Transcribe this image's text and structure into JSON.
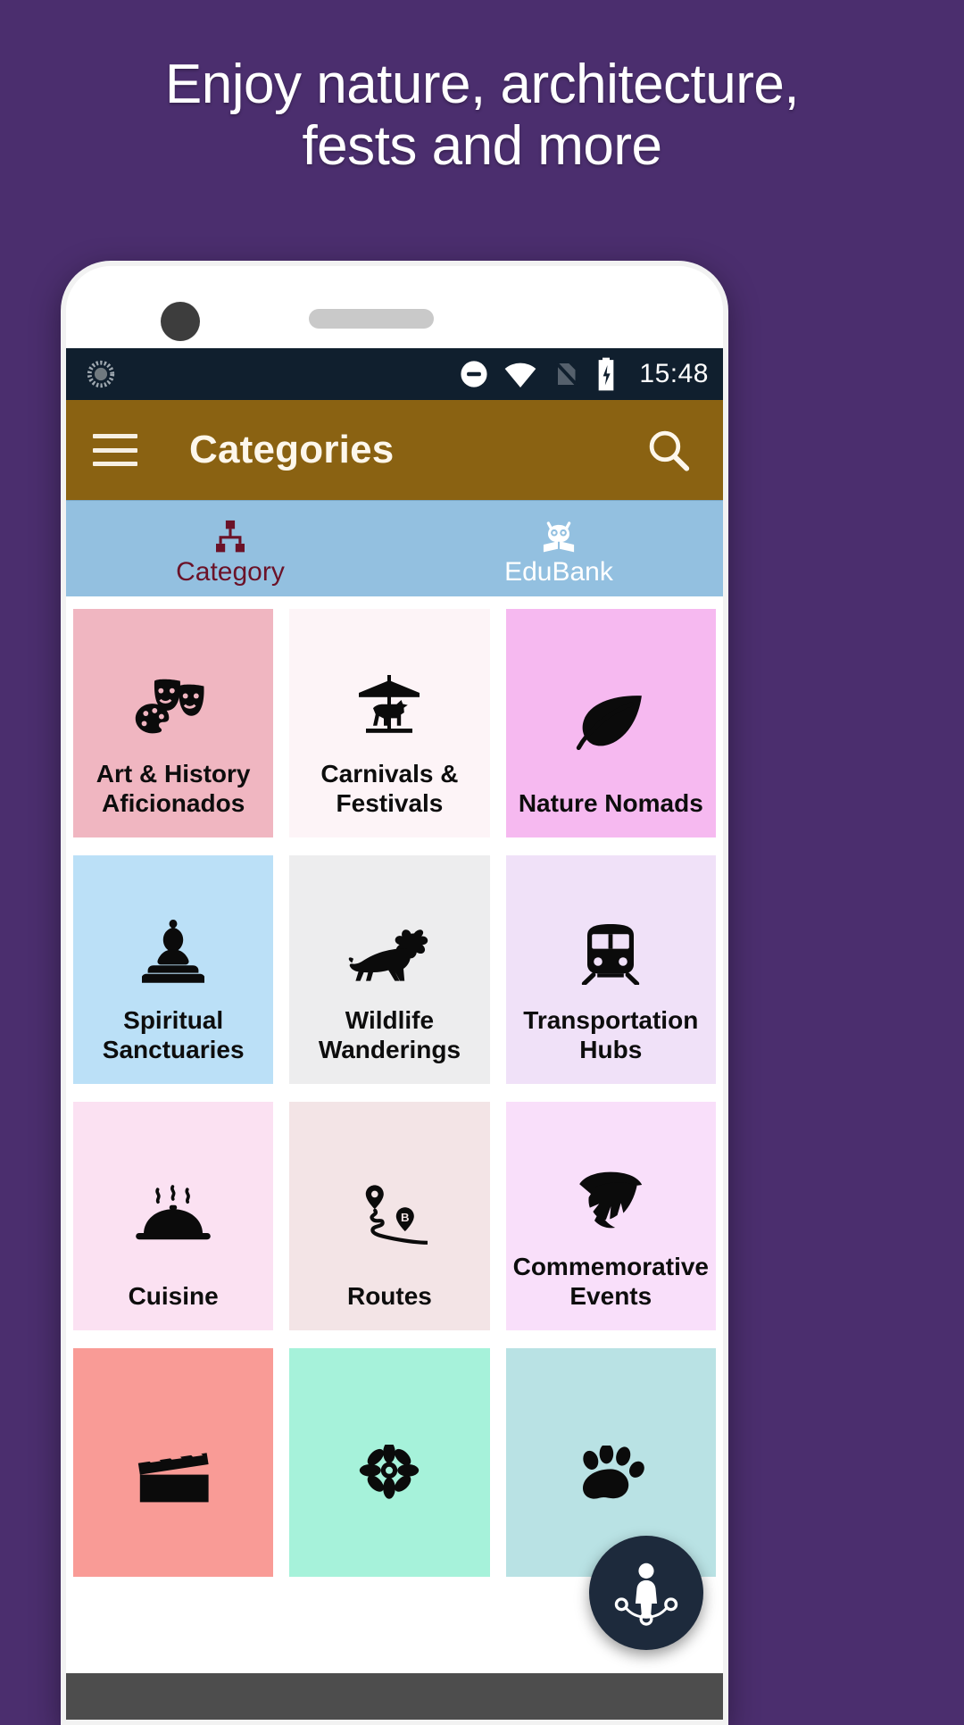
{
  "promo": {
    "headline_line1": "Enjoy nature, architecture,",
    "headline_line2": "fests and more",
    "background_color": "#4b2e6e",
    "text_color": "#ffffff"
  },
  "statusbar": {
    "time": "15:48",
    "icons": [
      "sync-spinner-icon",
      "do-not-disturb-icon",
      "wifi-icon",
      "no-sim-icon",
      "battery-charging-icon"
    ],
    "background_color": "#101f2e"
  },
  "toolbar": {
    "menu_icon": "hamburger-menu-icon",
    "title": "Categories",
    "search_icon": "search-icon",
    "background_color": "#8a6212",
    "text_color": "#fdf7ec"
  },
  "tabs": {
    "background_color": "#93c0e0",
    "active_color": "#6b1228",
    "inactive_color": "#ffffff",
    "items": [
      {
        "label": "Category",
        "icon": "sitemap-hierarchy-icon",
        "active": true
      },
      {
        "label": "EduBank",
        "icon": "owl-book-icon",
        "active": false
      }
    ]
  },
  "grid": {
    "cards": [
      {
        "label": "Art & History Aficionados",
        "icon": "theater-masks-palette-icon",
        "bg": "#f0b6c1"
      },
      {
        "label": "Carnivals & Festivals",
        "icon": "carousel-icon",
        "bg": "#fdf4f7"
      },
      {
        "label": "Nature Nomads",
        "icon": "leaf-icon",
        "bg": "#f6b9f0"
      },
      {
        "label": "Spiritual Sanctuaries",
        "icon": "buddha-icon",
        "bg": "#bbe0f7"
      },
      {
        "label": "Wildlife Wanderings",
        "icon": "lion-icon",
        "bg": "#ededee"
      },
      {
        "label": "Transportation Hubs",
        "icon": "train-icon",
        "bg": "#f0e1f8"
      },
      {
        "label": "Cuisine",
        "icon": "food-cloche-icon",
        "bg": "#fbe1f2"
      },
      {
        "label": "Routes",
        "icon": "route-a-to-b-icon",
        "bg": "#f3e4e6"
      },
      {
        "label": "Commemorative Events",
        "icon": "spartan-helmet-icon",
        "bg": "#f9dffa"
      },
      {
        "label": "",
        "icon": "clapperboard-icon",
        "bg": "#f99b96"
      },
      {
        "label": "",
        "icon": "flower-icon",
        "bg": "#a6f2da"
      },
      {
        "label": "",
        "icon": "paw-print-icon",
        "bg": "#b9e2e4"
      }
    ]
  },
  "fab": {
    "icon": "person-network-icon",
    "background_color": "#1d2a3c"
  }
}
